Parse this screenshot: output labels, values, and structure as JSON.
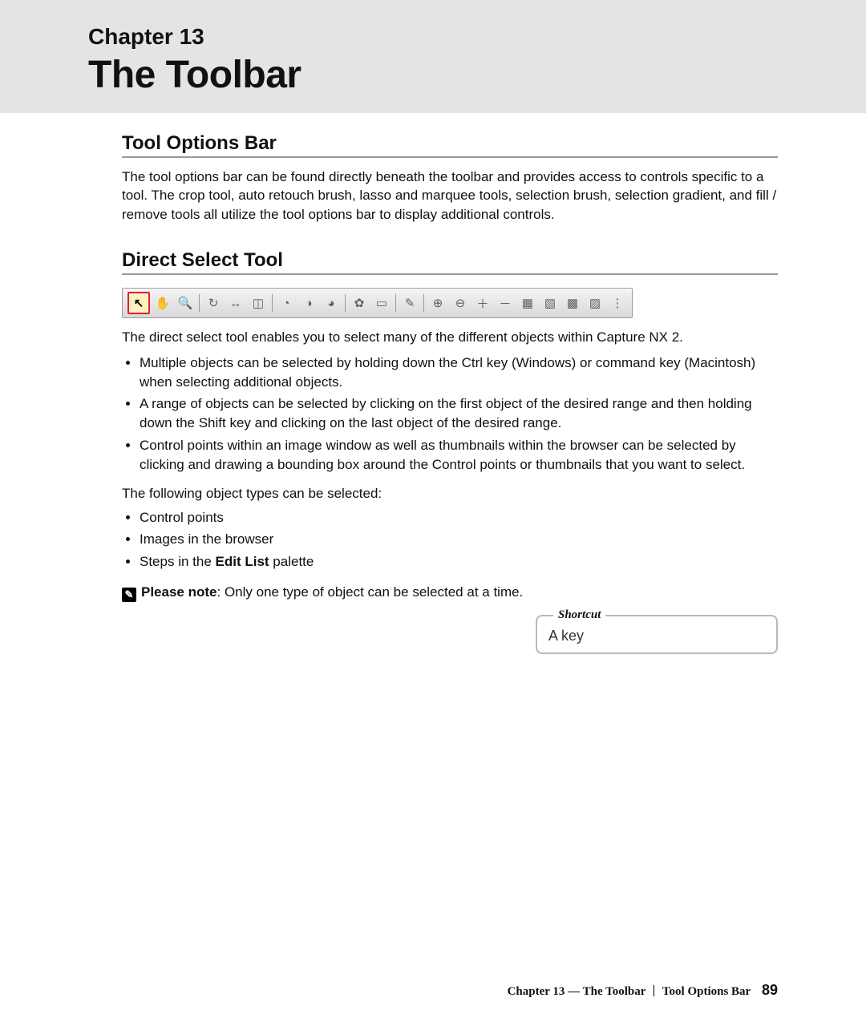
{
  "header": {
    "chapter_label": "Chapter 13",
    "chapter_title": "The Toolbar"
  },
  "section1": {
    "heading": "Tool Options Bar",
    "paragraph": "The tool options bar can be found directly beneath the toolbar and provides access to controls specific to a tool. The crop tool, auto retouch brush, lasso and marquee tools, selection brush, selection gradient, and fill / remove tools all utilize the tool options bar to display additional controls."
  },
  "section2": {
    "heading": "Direct Select Tool",
    "intro": "The direct select tool enables you to select many of the different objects within Capture NX 2.",
    "bullets_a": [
      "Multiple objects can be selected by holding down the Ctrl key (Windows) or command key (Macintosh) when selecting additional objects.",
      "A range of objects can be selected by clicking on the first object of the desired range and then holding down the Shift key and clicking on the last object of the desired range.",
      "Control points within an image window as well as thumbnails within the browser can be selected by clicking and drawing a bounding box around the Control points or thumbnails that you want to select."
    ],
    "subintro": "The following object types can be selected:",
    "bullets_b": [
      "Control points",
      "Images in the browser"
    ],
    "bullets_b_rich": {
      "prefix": "Steps in the ",
      "bold": "Edit List",
      "suffix": " palette"
    },
    "note": {
      "label": "Please note",
      "text": ": Only one type of object can be selected at a time."
    },
    "shortcut": {
      "legend": "Shortcut",
      "key": "A key"
    }
  },
  "toolbar": {
    "selected_index": 0,
    "icons": [
      "direct-select-icon",
      "hand-icon",
      "zoom-icon",
      "sep",
      "rotate-icon",
      "straighten-icon",
      "crop-icon",
      "sep",
      "black-point-icon",
      "neutral-point-icon",
      "white-point-icon",
      "sep",
      "lasso-icon",
      "marquee-icon",
      "sep",
      "auto-retouch-icon",
      "sep",
      "selection-brush-plus-icon",
      "selection-brush-minus-icon",
      "gradient-plus-icon",
      "gradient-minus-icon",
      "fill-plus-icon",
      "fill-minus-icon",
      "remove-plus-icon",
      "remove-minus-icon",
      "handle-icon"
    ]
  },
  "footer": {
    "chapter": "Chapter 13 — The Toolbar",
    "section": "Tool Options Bar",
    "page": "89"
  },
  "glyph_map": {
    "direct-select-icon": "↖",
    "hand-icon": "✋",
    "zoom-icon": "🔍",
    "rotate-icon": "↻",
    "straighten-icon": "↔",
    "crop-icon": "◫",
    "black-point-icon": "◔",
    "neutral-point-icon": "◑",
    "white-point-icon": "◕",
    "lasso-icon": "✿",
    "marquee-icon": "▭",
    "auto-retouch-icon": "✎",
    "selection-brush-plus-icon": "⊕",
    "selection-brush-minus-icon": "⊖",
    "gradient-plus-icon": "＋",
    "gradient-minus-icon": "－",
    "fill-plus-icon": "▦",
    "fill-minus-icon": "▧",
    "remove-plus-icon": "▩",
    "remove-minus-icon": "▨",
    "handle-icon": "⋮"
  }
}
